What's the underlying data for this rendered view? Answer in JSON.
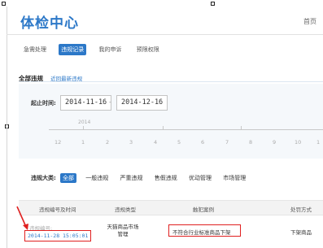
{
  "header": {
    "title": "体检中心",
    "home_link": "首页"
  },
  "tabs": [
    {
      "label": "急需处理",
      "active": false
    },
    {
      "label": "违规记录",
      "active": true
    },
    {
      "label": "我的申诉",
      "active": false
    },
    {
      "label": "预限权限",
      "active": false
    }
  ],
  "section": {
    "title": "全部违规",
    "link": "近回最新违规"
  },
  "date_range": {
    "label": "起止时间:",
    "start": "2014-11-16",
    "separator": "-",
    "end": "2014-12-16"
  },
  "timeline": {
    "year": "2014",
    "months": [
      "12",
      "1",
      "2",
      "3",
      "4",
      "5",
      "6",
      "7",
      "8",
      "9",
      "10",
      "1"
    ]
  },
  "filter": {
    "label": "违规大类:",
    "options": [
      {
        "label": "全部",
        "active": true
      },
      {
        "label": "一般违规",
        "active": false
      },
      {
        "label": "严重违规",
        "active": false
      },
      {
        "label": "售假违规",
        "active": false
      },
      {
        "label": "优动管理",
        "active": false
      },
      {
        "label": "市场管理",
        "active": false
      }
    ]
  },
  "table": {
    "columns": [
      "违规编号及时间",
      "违规类型",
      "触犯案例",
      "处罚方式"
    ],
    "rows": [
      {
        "id_label": "违规编号:",
        "time": "2014-11-28 15:05:01",
        "type": "天猫商品市场管理",
        "case": "不符合行业标准商品下架",
        "penalty": "下架商品"
      }
    ]
  },
  "colors": {
    "accent": "#2c78c8",
    "highlight": "#e02020"
  }
}
